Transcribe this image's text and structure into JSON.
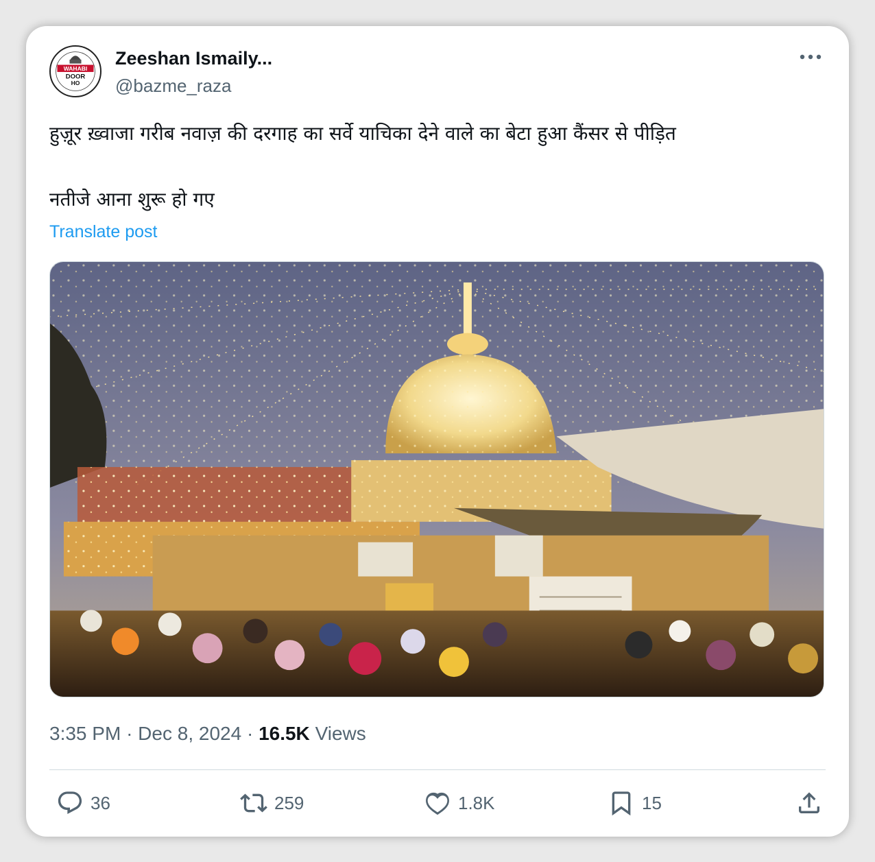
{
  "author": {
    "display_name": "Zeeshan Ismaily...",
    "handle": "@bazme_raza",
    "avatar": {
      "badge_text_1": "WAHABI",
      "badge_text_2": "DOOR",
      "badge_text_3": "HO",
      "badge_color": "#c8102e"
    }
  },
  "post": {
    "text_line_1": "हुज़ूर ख़्वाजा गरीब नवाज़ की दरगाह का सर्वे याचिका देने वाले का बेटा हुआ कैंसर से पीड़ित",
    "text_line_2": "नतीजे आना शुरू हो गए",
    "translate_label": "Translate post",
    "time": "3:35 PM",
    "date": "Dec 8, 2024",
    "separator": "·",
    "views_count": "16.5K",
    "views_label": "Views"
  },
  "actions": {
    "replies": "36",
    "reposts": "259",
    "likes": "1.8K",
    "bookmarks": "15"
  },
  "icons": {
    "more": "more-icon",
    "reply": "reply-icon",
    "repost": "repost-icon",
    "like": "heart-icon",
    "bookmark": "bookmark-icon",
    "share": "share-icon"
  },
  "colors": {
    "link": "#1d9bf0",
    "secondary_text": "#536471",
    "primary_text": "#0f1419"
  }
}
